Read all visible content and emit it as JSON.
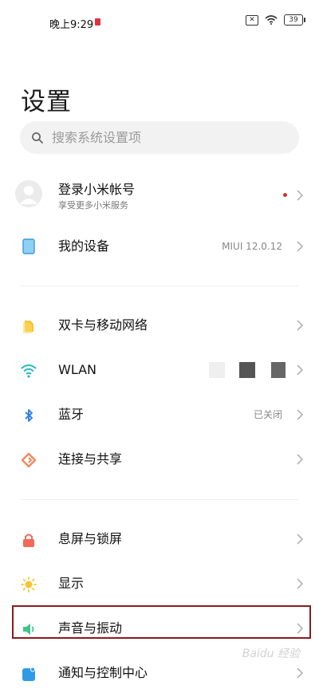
{
  "status_bar": {
    "time": "晚上9:29",
    "battery": "39"
  },
  "page": {
    "title": "设置"
  },
  "search": {
    "placeholder": "搜索系统设置项"
  },
  "account": {
    "title": "登录小米帐号",
    "subtitle": "享受更多小米服务"
  },
  "my_device": {
    "label": "我的设备",
    "value": "MIUI 12.0.12"
  },
  "network": [
    {
      "label": "双卡与移动网络",
      "value": "",
      "icon": "sim-card-icon",
      "color": "#f7c533"
    },
    {
      "label": "WLAN",
      "value": "",
      "icon": "wifi-icon",
      "color": "#25b7c8"
    },
    {
      "label": "蓝牙",
      "value": "已关闭",
      "icon": "bluetooth-icon",
      "color": "#2f7fe0"
    },
    {
      "label": "连接与共享",
      "value": "",
      "icon": "share-icon",
      "color": "#f28a5c"
    }
  ],
  "display": [
    {
      "label": "息屏与锁屏",
      "value": "",
      "icon": "lock-icon",
      "color": "#f26a5a"
    },
    {
      "label": "显示",
      "value": "",
      "icon": "sun-icon",
      "color": "#f7c533"
    },
    {
      "label": "声音与振动",
      "value": "",
      "icon": "speaker-icon",
      "color": "#3ec58a"
    },
    {
      "label": "通知与控制中心",
      "value": "",
      "icon": "notification-icon",
      "color": "#2f9be6"
    }
  ],
  "watermark": {
    "text": "Baidu 经验"
  }
}
